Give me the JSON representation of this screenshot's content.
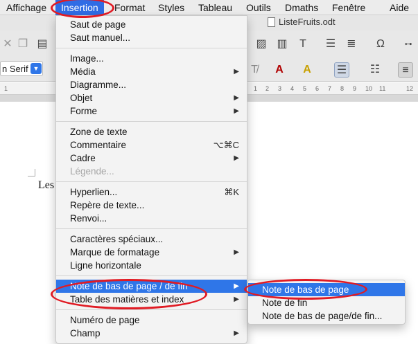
{
  "menubar": {
    "items": [
      "Affichage",
      "Insertion",
      "Format",
      "Styles",
      "Tableau",
      "Outils",
      "Dmaths",
      "Fenêtre",
      "Aide"
    ]
  },
  "document": {
    "title": "ListeFruits.odt",
    "body_text": "Les"
  },
  "toolbar": {
    "font_name": "n Serif",
    "ruler_ticks": [
      "1",
      "1",
      "2",
      "3",
      "4",
      "5",
      "6",
      "7",
      "8",
      "9",
      "10",
      "11",
      "12"
    ]
  },
  "insert_menu": {
    "groups": [
      [
        {
          "label": "Saut de page"
        },
        {
          "label": "Saut manuel..."
        }
      ],
      [
        {
          "label": "Image..."
        },
        {
          "label": "Média",
          "submenu": true
        },
        {
          "label": "Diagramme..."
        },
        {
          "label": "Objet",
          "submenu": true
        },
        {
          "label": "Forme",
          "submenu": true
        }
      ],
      [
        {
          "label": "Zone de texte"
        },
        {
          "label": "Commentaire",
          "shortcut": "⌥⌘C"
        },
        {
          "label": "Cadre",
          "submenu": true
        },
        {
          "label": "Légende...",
          "disabled": true
        }
      ],
      [
        {
          "label": "Hyperlien...",
          "shortcut": "⌘K"
        },
        {
          "label": "Repère de texte..."
        },
        {
          "label": "Renvoi..."
        }
      ],
      [
        {
          "label": "Caractères spéciaux..."
        },
        {
          "label": "Marque de formatage",
          "submenu": true
        },
        {
          "label": "Ligne horizontale"
        }
      ],
      [
        {
          "label": "Note de bas de page / de fin",
          "submenu": true,
          "highlighted": true
        },
        {
          "label": "Table des matières et index",
          "submenu": true
        }
      ],
      [
        {
          "label": "Numéro de page"
        },
        {
          "label": "Champ",
          "submenu": true
        }
      ]
    ]
  },
  "footnote_submenu": {
    "items": [
      {
        "label": "Note de bas de page",
        "highlighted": true
      },
      {
        "label": "Note de fin"
      },
      {
        "label": "Note de bas de page/de fin..."
      }
    ]
  },
  "colors": {
    "highlight": "#2f76e8",
    "annotation": "#e01b24"
  }
}
